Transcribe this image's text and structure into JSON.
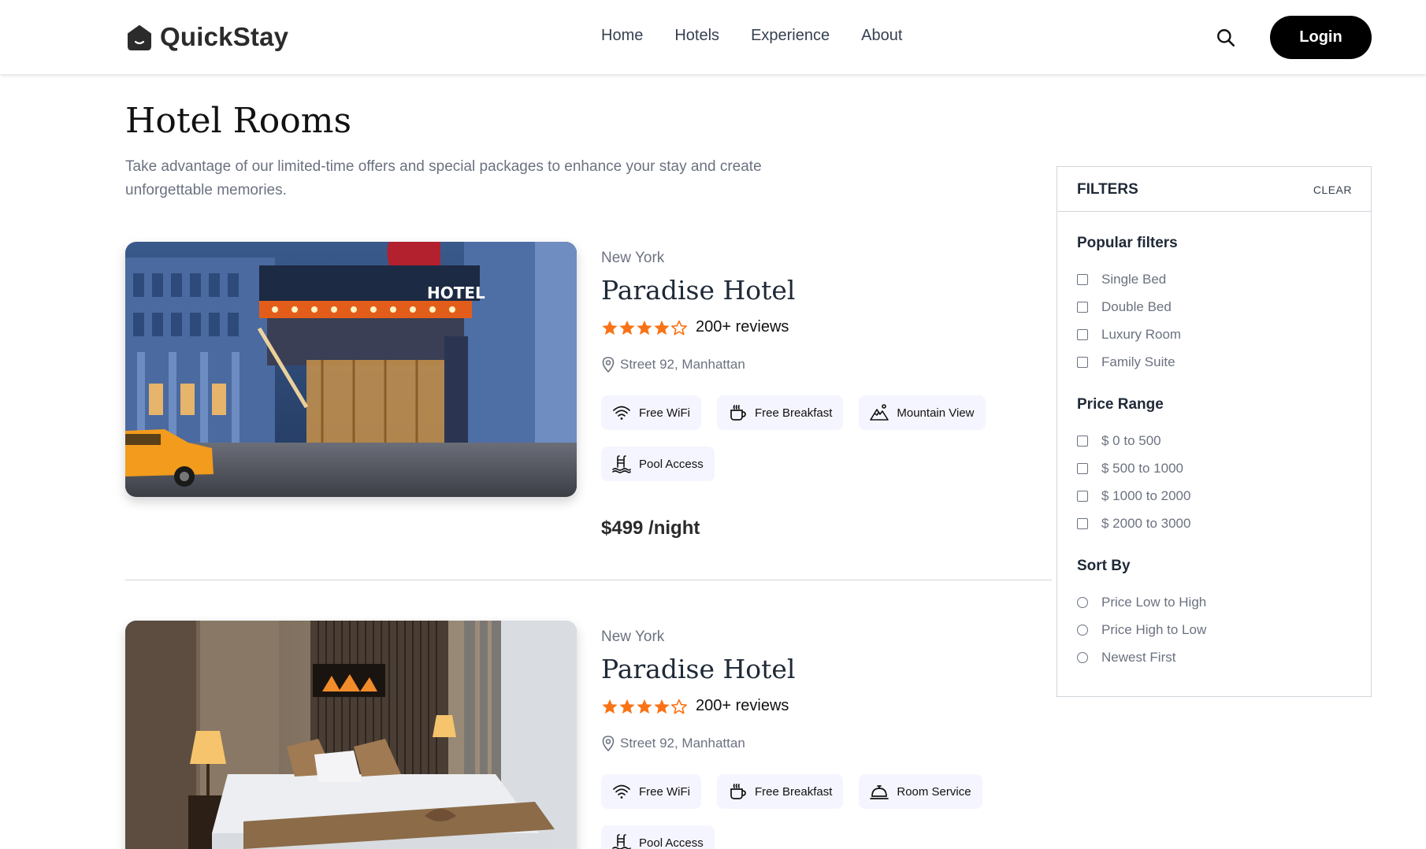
{
  "brand": {
    "name": "QuickStay"
  },
  "nav": {
    "links": [
      "Home",
      "Hotels",
      "Experience",
      "About"
    ],
    "login_label": "Login"
  },
  "header": {
    "title": "Hotel Rooms",
    "subtitle": "Take advantage of our limited-time offers and special packages to enhance your stay and create unforgettable memories."
  },
  "hotels": [
    {
      "city": "New York",
      "name": "Paradise Hotel",
      "rating": 4,
      "reviews": "200+ reviews",
      "address": "Street 92, Manhattan",
      "amenities": [
        {
          "label": "Free WiFi",
          "icon": "wifi-icon"
        },
        {
          "label": "Free Breakfast",
          "icon": "breakfast-icon"
        },
        {
          "label": "Mountain View",
          "icon": "mountain-icon"
        },
        {
          "label": "Pool Access",
          "icon": "pool-icon"
        }
      ],
      "price": "$499 /night"
    },
    {
      "city": "New York",
      "name": "Paradise Hotel",
      "rating": 4,
      "reviews": "200+ reviews",
      "address": "Street 92, Manhattan",
      "amenities": [
        {
          "label": "Free WiFi",
          "icon": "wifi-icon"
        },
        {
          "label": "Free Breakfast",
          "icon": "breakfast-icon"
        },
        {
          "label": "Room Service",
          "icon": "room-service-icon"
        },
        {
          "label": "Pool Access",
          "icon": "pool-icon"
        }
      ]
    }
  ],
  "filters": {
    "title": "FILTERS",
    "clear_label": "CLEAR",
    "popular_title": "Popular filters",
    "popular": [
      "Single Bed",
      "Double Bed",
      "Luxury Room",
      "Family Suite"
    ],
    "price_title": "Price Range",
    "price": [
      "$ 0 to 500",
      "$ 500 to 1000",
      "$ 1000 to 2000",
      "$ 2000 to 3000"
    ],
    "sort_title": "Sort By",
    "sort": [
      "Price Low to High",
      "Price High to Low",
      "Newest First"
    ]
  },
  "colors": {
    "star": "#f97316",
    "amenity_bg": "#f5f5ff",
    "login_bg": "#000000"
  }
}
